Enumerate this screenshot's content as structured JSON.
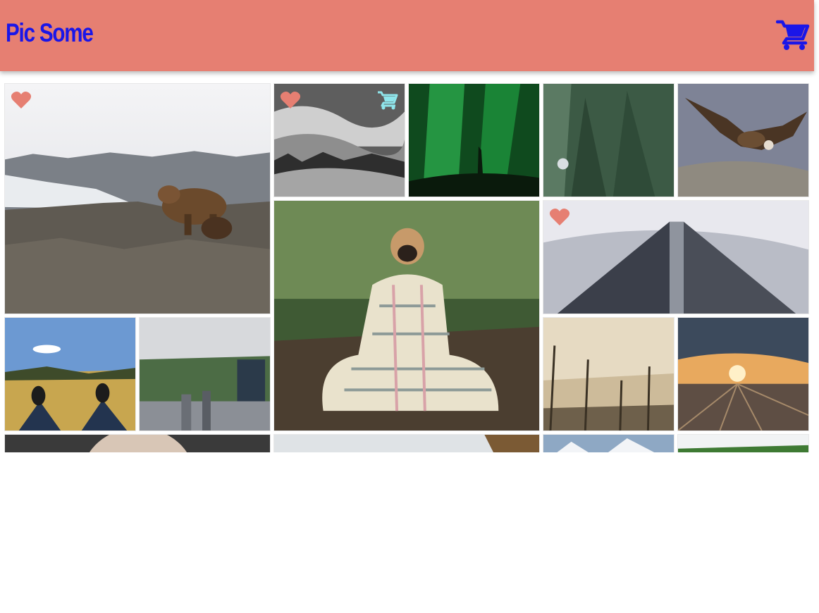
{
  "header": {
    "brand": "Pic Some",
    "cart_icon": "shopping-cart-icon",
    "brand_color": "#1a16e8",
    "background": "#e67f72"
  },
  "gallery": {
    "photos": [
      {
        "subject": "bear",
        "layout": "big",
        "favorited": true,
        "in_cart": false
      },
      {
        "subject": "foggy-forest",
        "layout": "normal",
        "favorited": true,
        "in_cart": true
      },
      {
        "subject": "aurora",
        "layout": "normal",
        "favorited": false,
        "in_cart": false
      },
      {
        "subject": "pine-trees",
        "layout": "normal",
        "favorited": false,
        "in_cart": false
      },
      {
        "subject": "eagle",
        "layout": "normal",
        "favorited": false,
        "in_cart": false
      },
      {
        "subject": "pug-in-blanket",
        "layout": "big",
        "favorited": false,
        "in_cart": false
      },
      {
        "subject": "skyscraper",
        "layout": "wide",
        "favorited": true,
        "in_cart": false
      },
      {
        "subject": "sneakers-in-field",
        "layout": "normal",
        "favorited": false,
        "in_cart": false
      },
      {
        "subject": "city-park",
        "layout": "normal",
        "favorited": false,
        "in_cart": false
      },
      {
        "subject": "dead-trees",
        "layout": "normal",
        "favorited": false,
        "in_cart": false
      },
      {
        "subject": "rail-yard-sunset",
        "layout": "normal",
        "favorited": false,
        "in_cart": false
      },
      {
        "subject": "portrait",
        "layout": "wide",
        "favorited": false,
        "in_cart": false
      },
      {
        "subject": "lake-shore",
        "layout": "wide",
        "favorited": false,
        "in_cart": false
      },
      {
        "subject": "snowy-mountains",
        "layout": "normal",
        "favorited": false,
        "in_cart": false
      },
      {
        "subject": "grass-field",
        "layout": "normal",
        "favorited": false,
        "in_cart": false
      }
    ],
    "heart_icon": "heart-icon",
    "heart_color": "#e67f72",
    "cart_add_icon": "add-to-cart-icon",
    "cart_add_color": "#8fe6ec"
  }
}
